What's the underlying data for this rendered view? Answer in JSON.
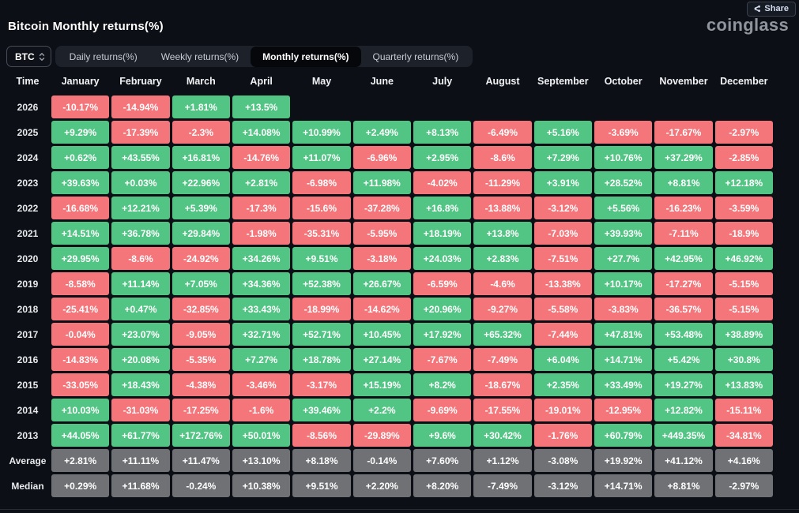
{
  "header": {
    "title": "Bitcoin Monthly returns(%)",
    "logo": "coinglass",
    "share_label": "Share"
  },
  "controls": {
    "symbol_select": {
      "value": "BTC"
    },
    "tabs": [
      {
        "label": "Daily returns(%)",
        "active": false
      },
      {
        "label": "Weekly returns(%)",
        "active": false
      },
      {
        "label": "Monthly returns(%)",
        "active": true
      },
      {
        "label": "Quarterly returns(%)",
        "active": false
      }
    ]
  },
  "colors": {
    "positive": "#52c584",
    "negative": "#f4767b",
    "neutral": "#6f7175",
    "background": "#0c0f15"
  },
  "chart_data": {
    "type": "heatmap",
    "title": "Bitcoin Monthly returns(%)",
    "columns": [
      "Time",
      "January",
      "February",
      "March",
      "April",
      "May",
      "June",
      "July",
      "August",
      "September",
      "October",
      "November",
      "December"
    ],
    "rows": [
      {
        "label": "2026",
        "kind": "year",
        "values": [
          "-10.17%",
          "-14.94%",
          "+1.81%",
          "+13.5%",
          null,
          null,
          null,
          null,
          null,
          null,
          null,
          null
        ]
      },
      {
        "label": "2025",
        "kind": "year",
        "values": [
          "+9.29%",
          "-17.39%",
          "-2.3%",
          "+14.08%",
          "+10.99%",
          "+2.49%",
          "+8.13%",
          "-6.49%",
          "+5.16%",
          "-3.69%",
          "-17.67%",
          "-2.97%"
        ]
      },
      {
        "label": "2024",
        "kind": "year",
        "values": [
          "+0.62%",
          "+43.55%",
          "+16.81%",
          "-14.76%",
          "+11.07%",
          "-6.96%",
          "+2.95%",
          "-8.6%",
          "+7.29%",
          "+10.76%",
          "+37.29%",
          "-2.85%"
        ]
      },
      {
        "label": "2023",
        "kind": "year",
        "values": [
          "+39.63%",
          "+0.03%",
          "+22.96%",
          "+2.81%",
          "-6.98%",
          "+11.98%",
          "-4.02%",
          "-11.29%",
          "+3.91%",
          "+28.52%",
          "+8.81%",
          "+12.18%"
        ]
      },
      {
        "label": "2022",
        "kind": "year",
        "values": [
          "-16.68%",
          "+12.21%",
          "+5.39%",
          "-17.3%",
          "-15.6%",
          "-37.28%",
          "+16.8%",
          "-13.88%",
          "-3.12%",
          "+5.56%",
          "-16.23%",
          "-3.59%"
        ]
      },
      {
        "label": "2021",
        "kind": "year",
        "values": [
          "+14.51%",
          "+36.78%",
          "+29.84%",
          "-1.98%",
          "-35.31%",
          "-5.95%",
          "+18.19%",
          "+13.8%",
          "-7.03%",
          "+39.93%",
          "-7.11%",
          "-18.9%"
        ]
      },
      {
        "label": "2020",
        "kind": "year",
        "values": [
          "+29.95%",
          "-8.6%",
          "-24.92%",
          "+34.26%",
          "+9.51%",
          "-3.18%",
          "+24.03%",
          "+2.83%",
          "-7.51%",
          "+27.7%",
          "+42.95%",
          "+46.92%"
        ]
      },
      {
        "label": "2019",
        "kind": "year",
        "values": [
          "-8.58%",
          "+11.14%",
          "+7.05%",
          "+34.36%",
          "+52.38%",
          "+26.67%",
          "-6.59%",
          "-4.6%",
          "-13.38%",
          "+10.17%",
          "-17.27%",
          "-5.15%"
        ]
      },
      {
        "label": "2018",
        "kind": "year",
        "values": [
          "-25.41%",
          "+0.47%",
          "-32.85%",
          "+33.43%",
          "-18.99%",
          "-14.62%",
          "+20.96%",
          "-9.27%",
          "-5.58%",
          "-3.83%",
          "-36.57%",
          "-5.15%"
        ]
      },
      {
        "label": "2017",
        "kind": "year",
        "values": [
          "-0.04%",
          "+23.07%",
          "-9.05%",
          "+32.71%",
          "+52.71%",
          "+10.45%",
          "+17.92%",
          "+65.32%",
          "-7.44%",
          "+47.81%",
          "+53.48%",
          "+38.89%"
        ]
      },
      {
        "label": "2016",
        "kind": "year",
        "values": [
          "-14.83%",
          "+20.08%",
          "-5.35%",
          "+7.27%",
          "+18.78%",
          "+27.14%",
          "-7.67%",
          "-7.49%",
          "+6.04%",
          "+14.71%",
          "+5.42%",
          "+30.8%"
        ]
      },
      {
        "label": "2015",
        "kind": "year",
        "values": [
          "-33.05%",
          "+18.43%",
          "-4.38%",
          "-3.46%",
          "-3.17%",
          "+15.19%",
          "+8.2%",
          "-18.67%",
          "+2.35%",
          "+33.49%",
          "+19.27%",
          "+13.83%"
        ]
      },
      {
        "label": "2014",
        "kind": "year",
        "values": [
          "+10.03%",
          "-31.03%",
          "-17.25%",
          "-1.6%",
          "+39.46%",
          "+2.2%",
          "-9.69%",
          "-17.55%",
          "-19.01%",
          "-12.95%",
          "+12.82%",
          "-15.11%"
        ]
      },
      {
        "label": "2013",
        "kind": "year",
        "values": [
          "+44.05%",
          "+61.77%",
          "+172.76%",
          "+50.01%",
          "-8.56%",
          "-29.89%",
          "+9.6%",
          "+30.42%",
          "-1.76%",
          "+60.79%",
          "+449.35%",
          "-34.81%"
        ]
      },
      {
        "label": "Average",
        "kind": "summary",
        "values": [
          "+2.81%",
          "+11.11%",
          "+11.47%",
          "+13.10%",
          "+8.18%",
          "-0.14%",
          "+7.60%",
          "+1.12%",
          "-3.08%",
          "+19.92%",
          "+41.12%",
          "+4.16%"
        ]
      },
      {
        "label": "Median",
        "kind": "summary",
        "values": [
          "+0.29%",
          "+11.68%",
          "-0.24%",
          "+10.38%",
          "+9.51%",
          "+2.20%",
          "+8.20%",
          "-7.49%",
          "-3.12%",
          "+14.71%",
          "+8.81%",
          "-2.97%"
        ]
      }
    ]
  }
}
